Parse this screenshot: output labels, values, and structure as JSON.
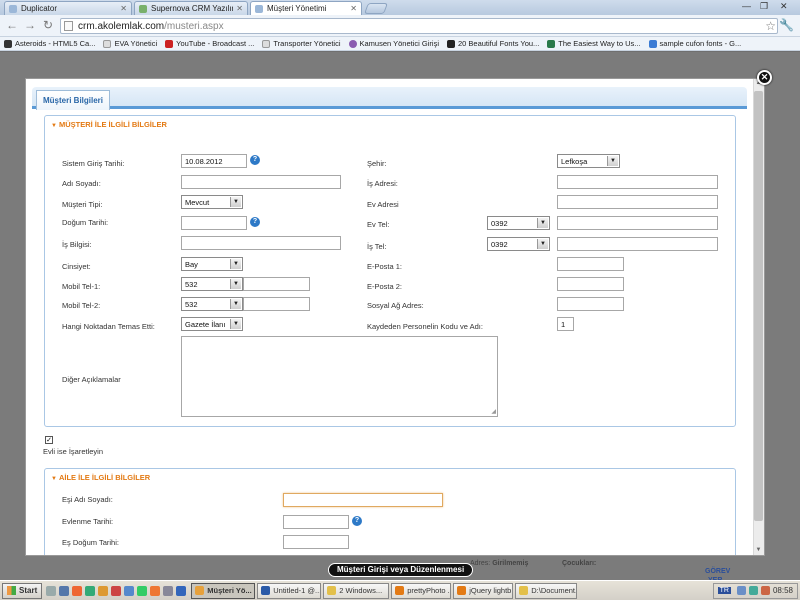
{
  "browser": {
    "tabs": [
      {
        "label": "Duplicator",
        "color": "#7aa0d0"
      },
      {
        "label": "Supernova CRM Yazılımı",
        "color": "#79b06b"
      },
      {
        "label": "Müşteri Yönetimi",
        "color": "#9bb7d8"
      }
    ],
    "url_host": "crm.akolemlak.com",
    "url_path": "/musteri.aspx",
    "bookmarks": [
      {
        "label": "Asteroids - HTML5 Ca...",
        "color": "#333333"
      },
      {
        "label": "EVA Yönetici",
        "color": "#dddddd"
      },
      {
        "label": "YouTube - Broadcast ...",
        "color": "#cc2222"
      },
      {
        "label": "Transporter Yönetici",
        "color": "#dddddd"
      },
      {
        "label": "Kamusen Yönetici Girişi",
        "color": "#8a5bb0"
      },
      {
        "label": "20 Beautiful Fonts You...",
        "color": "#222222"
      },
      {
        "label": "The Easiest Way to Us...",
        "color": "#2a7a4a"
      },
      {
        "label": "sample cufon fonts - G...",
        "color": "#3b7bd4"
      }
    ]
  },
  "modal": {
    "tab_label": "Müşteri Bilgileri",
    "section1_title": "MÜŞTERİ İLE İLGİLİ BİLGİLER",
    "section2_title": "AİLE İLE İLGİLİ BİLGİLER",
    "fields": {
      "sistem_giris_tarihi": {
        "label": "Sistem Giriş Tarihi:",
        "value": "10.08.2012"
      },
      "ad_soyad": {
        "label": "Adı Soyadı:",
        "value": ""
      },
      "musteri_tipi": {
        "label": "Müşteri Tipi:",
        "value": "Mevcut"
      },
      "dogum_tarihi": {
        "label": "Doğum Tarihi:",
        "value": ""
      },
      "is_bilgisi": {
        "label": "İş Bilgisi:",
        "value": ""
      },
      "cinsiyet": {
        "label": "Cinsiyet:",
        "value": "Bay"
      },
      "mobil_tel_1": {
        "label": "Mobil Tel-1:",
        "code": "532",
        "value": ""
      },
      "mobil_tel_2": {
        "label": "Mobil Tel-2:",
        "code": "532",
        "value": ""
      },
      "temas_noktasi": {
        "label": "Hangi Noktadan Temas Etti:",
        "value": "Gazete İlanı"
      },
      "diger_aciklamalar": {
        "label": "Diğer Açıklamalar",
        "value": ""
      },
      "sehir": {
        "label": "Şehir:",
        "value": "Lefkoşa"
      },
      "is_adresi": {
        "label": "İş Adresi:",
        "value": ""
      },
      "ev_adresi": {
        "label": "Ev Adresi",
        "value": ""
      },
      "ev_tel": {
        "label": "Ev Tel:",
        "code": "0392",
        "value": ""
      },
      "is_tel": {
        "label": "İş Tel:",
        "code": "0392",
        "value": ""
      },
      "eposta_1": {
        "label": "E-Posta 1:",
        "value": ""
      },
      "eposta_2": {
        "label": "E-Posta 2:",
        "value": ""
      },
      "sosyal_ag": {
        "label": "Sosyal Ağ Adres:",
        "value": ""
      },
      "personel_kodu": {
        "label": "Kaydeden Personelin Kodu ve Adı:",
        "value": "1"
      }
    },
    "evli_checkbox": {
      "label": "Evli ise İşaretleyin",
      "checked": "✓"
    },
    "family_fields": {
      "esi_adi_soyadi": {
        "label": "Eşi Adı Soyadı:",
        "value": ""
      },
      "evlenme_tarihi": {
        "label": "Evlenme Tarihi:",
        "value": ""
      },
      "es_dogum_tarihi": {
        "label": "Eş Doğum Tarihi:",
        "value": ""
      }
    }
  },
  "background": {
    "status_tooltip": "Müşteri Girişi veya Düzenlenmesi",
    "adres_label": "Adres:",
    "adres_value": "Girilmemiş",
    "cocuklari": "Çocukları:",
    "gorev": "GÖREV",
    "yer": "YER"
  },
  "taskbar": {
    "start": "Start",
    "tasks": [
      {
        "label": "Müşteri Yö...",
        "color": "#e7a13b",
        "active": true
      },
      {
        "label": "Untitled-1 @...",
        "color": "#2a5aa8"
      },
      {
        "label": "2 Windows...",
        "color": "#e3c04a"
      },
      {
        "label": "prettyPhoto ...",
        "color": "#e37a14"
      },
      {
        "label": "jQuery lightb...",
        "color": "#e37a14"
      },
      {
        "label": "D:\\Document...",
        "color": "#e3c04a"
      }
    ],
    "lang": "TR",
    "clock": "08:58"
  }
}
